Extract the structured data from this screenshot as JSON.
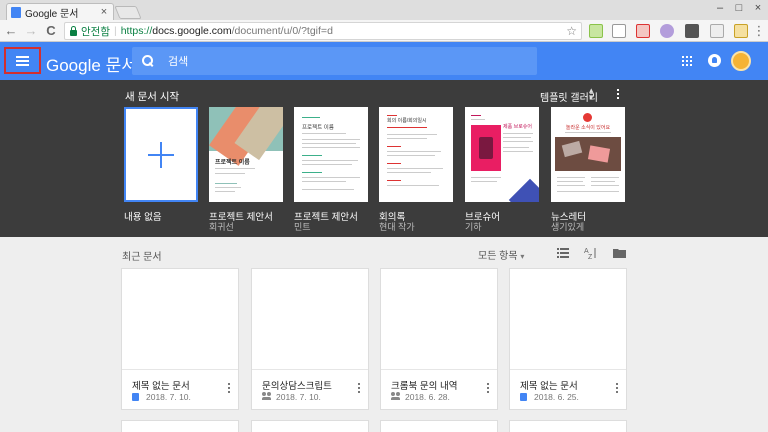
{
  "browser": {
    "tab_title": "Google 문서",
    "tab_close": "×",
    "secure_label": "안전함",
    "url_scheme": "https://",
    "url_host": "docs.google.com",
    "url_path": "/document/u/0/?tgif=d",
    "window_min": "–",
    "window_max": "□",
    "window_close": "×",
    "back": "←",
    "forward": "→",
    "reload": "C"
  },
  "appbar": {
    "brand_google": "Google",
    "brand_product": "문서",
    "search_placeholder": "검색"
  },
  "gallery": {
    "title": "새 문서 시작",
    "gallery_link": "템플릿 갤러리",
    "templates": [
      {
        "name": "내용 없음",
        "sub": ""
      },
      {
        "name": "프로젝트 제안서",
        "sub": "회귀선"
      },
      {
        "name": "프로젝트 제안서",
        "sub": "민트"
      },
      {
        "name": "회의록",
        "sub": "현대 작가"
      },
      {
        "name": "브로슈어",
        "sub": "기하"
      },
      {
        "name": "뉴스레터",
        "sub": "생기있게"
      }
    ],
    "thumb_texts": {
      "proposal_title": "프로젝트 이름",
      "mint_title": "프로젝트 이름",
      "minutes_title": "회의 이름/회의일시",
      "brochure_title": "제품 브로슈어",
      "newsletter_title": "놀라운 소식이 있어요"
    }
  },
  "recent": {
    "title": "최근 문서",
    "owner_filter": "모든 항목",
    "docs": [
      {
        "name": "제목 없는 문서",
        "date": "2018. 7. 10.",
        "shared": false
      },
      {
        "name": "문의상담스크립트",
        "date": "2018. 7. 10.",
        "shared": true
      },
      {
        "name": "크롬북 문의 내역",
        "date": "2018. 6. 28.",
        "shared": true
      },
      {
        "name": "제목 없는 문서",
        "date": "2018. 6. 25.",
        "shared": false
      }
    ]
  },
  "colors": {
    "brand_blue": "#4285f4",
    "gallery_bg": "#3c3c3c",
    "highlight_red": "#d32f2f"
  },
  "icons": {
    "menu": "hamburger-icon",
    "search": "search-icon",
    "apps": "apps-grid-icon",
    "notifications": "notifications-icon",
    "sort": "sort-az-icon",
    "list_view": "list-view-icon",
    "folder": "folder-icon"
  }
}
